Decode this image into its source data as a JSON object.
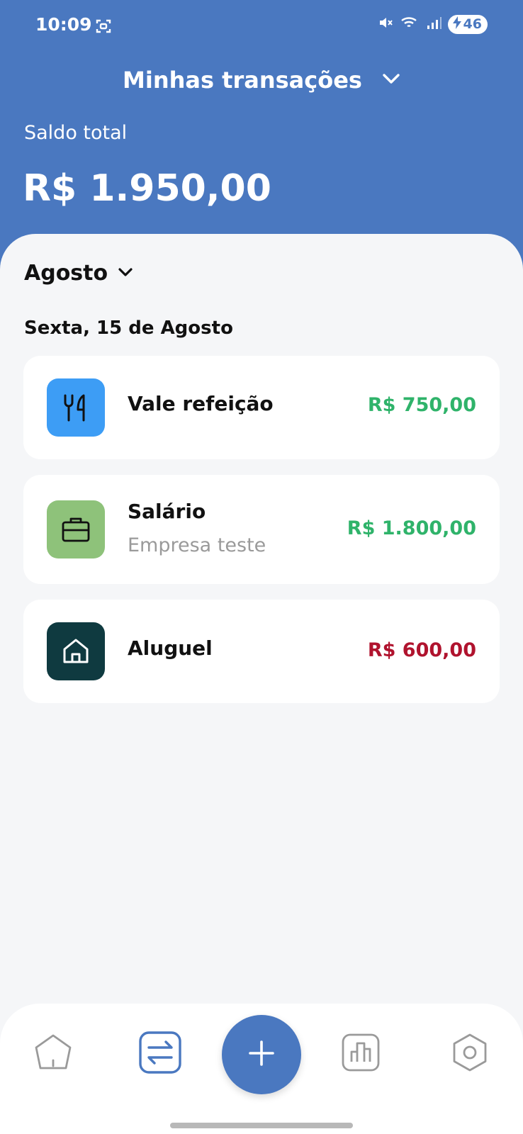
{
  "status": {
    "time": "10:09",
    "battery": "46"
  },
  "header": {
    "title": "Minhas transações",
    "balance_label": "Saldo total",
    "balance_value": "R$ 1.950,00"
  },
  "filter": {
    "month": "Agosto"
  },
  "group": {
    "date": "Sexta, 15 de Agosto"
  },
  "transactions": [
    {
      "title": "Vale refeição",
      "subtitle": "",
      "amount": "R$ 750,00",
      "type": "income",
      "icon": "fork-knife-icon",
      "icon_bg": "#3d9df5"
    },
    {
      "title": "Salário",
      "subtitle": "Empresa teste",
      "amount": "R$ 1.800,00",
      "type": "income",
      "icon": "briefcase-icon",
      "icon_bg": "#8ec27a"
    },
    {
      "title": "Aluguel",
      "subtitle": "",
      "amount": "R$ 600,00",
      "type": "expense",
      "icon": "house-icon",
      "icon_bg": "#0f3a40"
    }
  ],
  "nav": {
    "items": [
      "home-icon",
      "transactions-icon",
      "add-icon",
      "chart-icon",
      "settings-icon"
    ],
    "active": "transactions-icon"
  },
  "colors": {
    "primary": "#4a78c0",
    "income": "#2fb36a",
    "expense": "#b0132e"
  }
}
